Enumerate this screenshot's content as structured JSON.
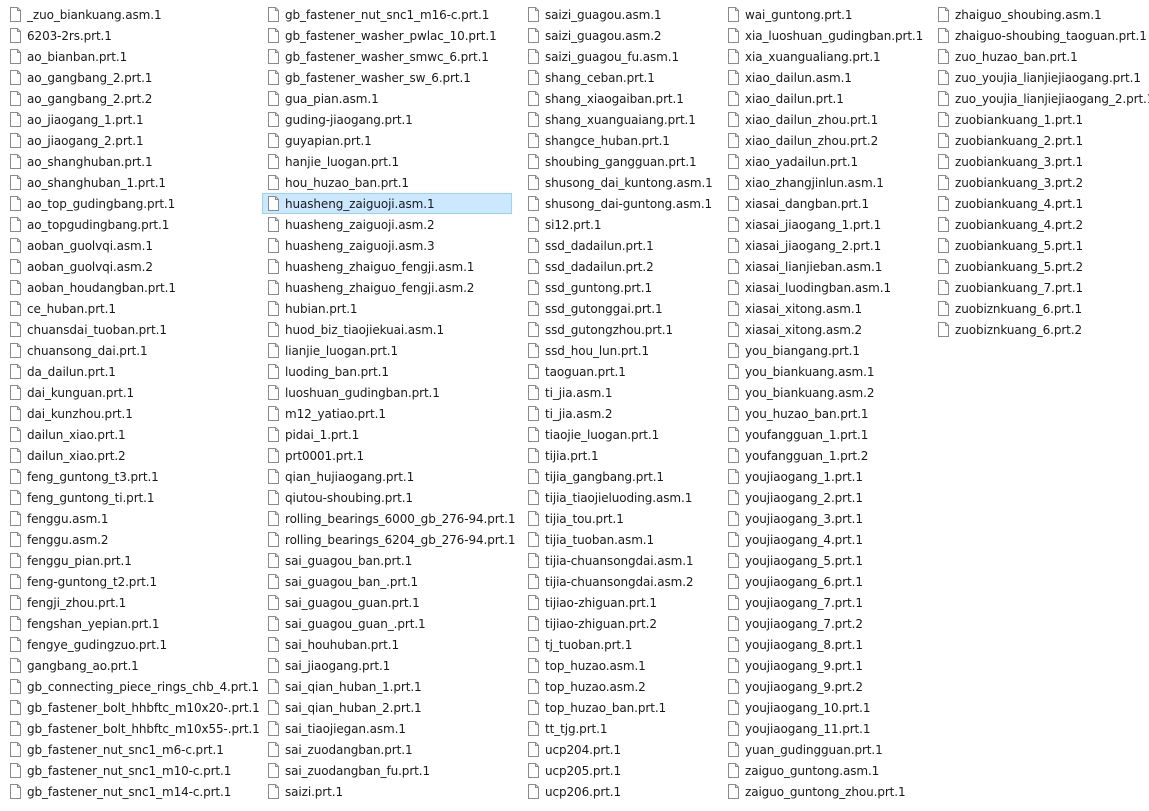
{
  "selected": "huasheng_zaiguoji.asm.1",
  "columns": [
    [
      "_zuo_biankuang.asm.1",
      "6203-2rs.prt.1",
      "ao_bianban.prt.1",
      "ao_gangbang_2.prt.1",
      "ao_gangbang_2.prt.2",
      "ao_jiaogang_1.prt.1",
      "ao_jiaogang_2.prt.1",
      "ao_shanghuban.prt.1",
      "ao_shanghuban_1.prt.1",
      "ao_top_gudingbang.prt.1",
      "ao_topgudingbang.prt.1",
      "aoban_guolvqi.asm.1",
      "aoban_guolvqi.asm.2",
      "aoban_houdangban.prt.1",
      "ce_huban.prt.1",
      "chuansdai_tuoban.prt.1",
      "chuansong_dai.prt.1",
      "da_dailun.prt.1",
      "dai_kunguan.prt.1",
      "dai_kunzhou.prt.1",
      "dailun_xiao.prt.1",
      "dailun_xiao.prt.2",
      "feng_guntong_t3.prt.1",
      "feng_guntong_ti.prt.1",
      "fenggu.asm.1",
      "fenggu.asm.2",
      "fenggu_pian.prt.1",
      "feng-guntong_t2.prt.1",
      "fengji_zhou.prt.1",
      "fengshan_yepian.prt.1",
      "fengye_gudingzuo.prt.1",
      "gangbang_ao.prt.1",
      "gb_connecting_piece_rings_chb_4.prt.1",
      "gb_fastener_bolt_hhbftc_m10x20-.prt.1",
      "gb_fastener_bolt_hhbftc_m10x55-.prt.1",
      "gb_fastener_nut_snc1_m6-c.prt.1",
      "gb_fastener_nut_snc1_m10-c.prt.1",
      "gb_fastener_nut_snc1_m14-c.prt.1"
    ],
    [
      "gb_fastener_nut_snc1_m16-c.prt.1",
      "gb_fastener_washer_pwlac_10.prt.1",
      "gb_fastener_washer_smwc_6.prt.1",
      "gb_fastener_washer_sw_6.prt.1",
      "gua_pian.asm.1",
      "guding-jiaogang.prt.1",
      "guyapian.prt.1",
      "hanjie_luogan.prt.1",
      "hou_huzao_ban.prt.1",
      "huasheng_zaiguoji.asm.1",
      "huasheng_zaiguoji.asm.2",
      "huasheng_zaiguoji.asm.3",
      "huasheng_zhaiguo_fengji.asm.1",
      "huasheng_zhaiguo_fengji.asm.2",
      "hubian.prt.1",
      "huod_biz_tiaojiekuai.asm.1",
      "lianjie_luogan.prt.1",
      "luoding_ban.prt.1",
      "luoshuan_gudingban.prt.1",
      "m12_yatiao.prt.1",
      "pidai_1.prt.1",
      "prt0001.prt.1",
      "qian_hujiaogang.prt.1",
      "qiutou-shoubing.prt.1",
      "rolling_bearings_6000_gb_276-94.prt.1",
      "rolling_bearings_6204_gb_276-94.prt.1",
      "sai_guagou_ban.prt.1",
      "sai_guagou_ban_.prt.1",
      "sai_guagou_guan.prt.1",
      "sai_guagou_guan_.prt.1",
      "sai_houhuban.prt.1",
      "sai_jiaogang.prt.1",
      "sai_qian_huban_1.prt.1",
      "sai_qian_huban_2.prt.1",
      "sai_tiaojiegan.asm.1",
      "sai_zuodangban.prt.1",
      "sai_zuodangban_fu.prt.1",
      "saizi.prt.1"
    ],
    [
      "saizi_guagou.asm.1",
      "saizi_guagou.asm.2",
      "saizi_guagou_fu.asm.1",
      "shang_ceban.prt.1",
      "shang_xiaogaiban.prt.1",
      "shang_xuanguaiang.prt.1",
      "shangce_huban.prt.1",
      "shoubing_gangguan.prt.1",
      "shusong_dai_kuntong.asm.1",
      "shusong_dai-guntong.asm.1",
      "si12.prt.1",
      "ssd_dadailun.prt.1",
      "ssd_dadailun.prt.2",
      "ssd_guntong.prt.1",
      "ssd_gutonggai.prt.1",
      "ssd_gutongzhou.prt.1",
      "ssd_hou_lun.prt.1",
      "taoguan.prt.1",
      "ti_jia.asm.1",
      "ti_jia.asm.2",
      "tiaojie_luogan.prt.1",
      "tijia.prt.1",
      "tijia_gangbang.prt.1",
      "tijia_tiaojieluoding.asm.1",
      "tijia_tou.prt.1",
      "tijia_tuoban.asm.1",
      "tijia-chuansongdai.asm.1",
      "tijia-chuansongdai.asm.2",
      "tijiao-zhiguan.prt.1",
      "tijiao-zhiguan.prt.2",
      "tj_tuoban.prt.1",
      "top_huzao.asm.1",
      "top_huzao.asm.2",
      "top_huzao_ban.prt.1",
      "tt_tjg.prt.1",
      "ucp204.prt.1",
      "ucp205.prt.1",
      "ucp206.prt.1"
    ],
    [
      "wai_guntong.prt.1",
      "xia_luoshuan_gudingban.prt.1",
      "xia_xuangualiang.prt.1",
      "xiao_dailun.asm.1",
      "xiao_dailun.prt.1",
      "xiao_dailun_zhou.prt.1",
      "xiao_dailun_zhou.prt.2",
      "xiao_yadailun.prt.1",
      "xiao_zhangjinlun.asm.1",
      "xiasai_dangban.prt.1",
      "xiasai_jiaogang_1.prt.1",
      "xiasai_jiaogang_2.prt.1",
      "xiasai_lianjieban.asm.1",
      "xiasai_luodingban.asm.1",
      "xiasai_xitong.asm.1",
      "xiasai_xitong.asm.2",
      "you_biangang.prt.1",
      "you_biankuang.asm.1",
      "you_biankuang.asm.2",
      "you_huzao_ban.prt.1",
      "youfangguan_1.prt.1",
      "youfangguan_1.prt.2",
      "youjiaogang_1.prt.1",
      "youjiaogang_2.prt.1",
      "youjiaogang_3.prt.1",
      "youjiaogang_4.prt.1",
      "youjiaogang_5.prt.1",
      "youjiaogang_6.prt.1",
      "youjiaogang_7.prt.1",
      "youjiaogang_7.prt.2",
      "youjiaogang_8.prt.1",
      "youjiaogang_9.prt.1",
      "youjiaogang_9.prt.2",
      "youjiaogang_10.prt.1",
      "youjiaogang_11.prt.1",
      "yuan_gudingguan.prt.1",
      "zaiguo_guntong.asm.1",
      "zaiguo_guntong_zhou.prt.1"
    ],
    [
      "zhaiguo_shoubing.asm.1",
      "zhaiguo-shoubing_taoguan.prt.1",
      "zuo_huzao_ban.prt.1",
      "zuo_youjia_lianjiejiaogang.prt.1",
      "zuo_youjia_lianjiejiaogang_2.prt.1",
      "zuobiankuang_1.prt.1",
      "zuobiankuang_2.prt.1",
      "zuobiankuang_3.prt.1",
      "zuobiankuang_3.prt.2",
      "zuobiankuang_4.prt.1",
      "zuobiankuang_4.prt.2",
      "zuobiankuang_5.prt.1",
      "zuobiankuang_5.prt.2",
      "zuobiankuang_7.prt.1",
      "zuobiznkuang_6.prt.1",
      "zuobiznkuang_6.prt.2"
    ]
  ],
  "icon": "blank-file-icon",
  "colors": {
    "selection_bg": "#cce8ff",
    "selection_border": "#99d1ff",
    "icon_stroke": "#8a8a8a"
  }
}
